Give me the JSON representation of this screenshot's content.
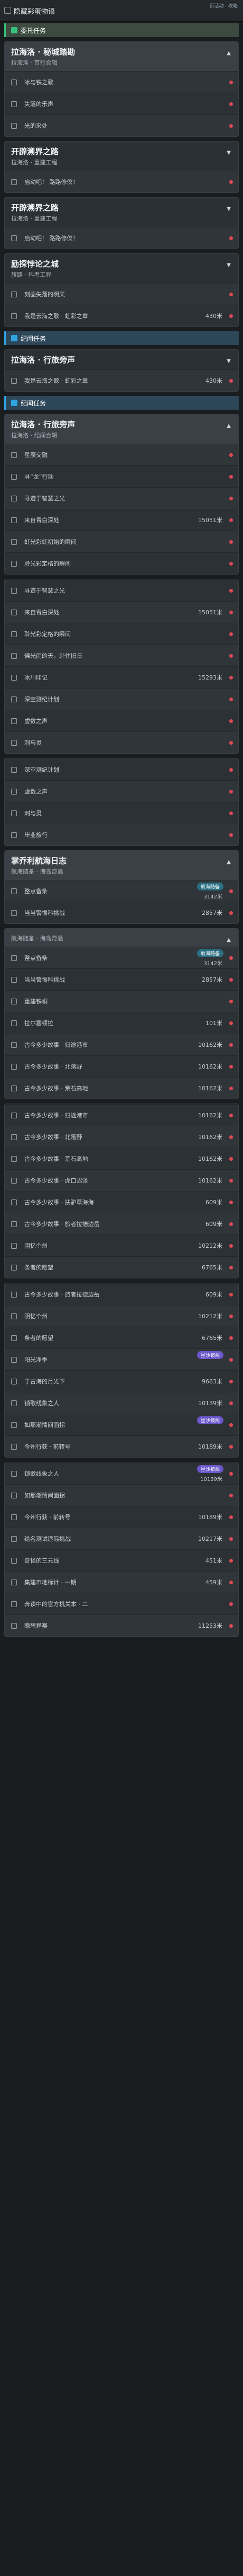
{
  "window": {
    "title": "隐藏彩蛋物语",
    "watermark": "新活动 · 攻略"
  },
  "sections": [
    {
      "type": "cat",
      "color": "green",
      "label": "委托任务"
    },
    {
      "type": "quest",
      "title": "拉海洛 · 秘城踏勘",
      "subtitle": "拉海洛 · 首行合辑",
      "open": true,
      "rows": [
        {
          "label": "冰与铁之歌"
        },
        {
          "label": "失落的乐声"
        },
        {
          "label": "光的来处"
        }
      ]
    },
    {
      "type": "quest",
      "title": "开辟溯界之路",
      "subtitle": "拉海洛 · 重建工程",
      "open": false,
      "rows": [
        {
          "label": "启动吧！ 路路修仪！"
        }
      ]
    },
    {
      "type": "quest",
      "title": "开辟溯界之路",
      "subtitle": "拉海洛 · 重建工程",
      "open": false,
      "rows": [
        {
          "label": "启动吧！ 路路修仪！"
        }
      ]
    },
    {
      "type": "quest",
      "title": "励探悖论之城",
      "subtitle": "旗路 · 科考工程",
      "open": false,
      "rows": [
        {
          "label": "刻画失落的明天"
        },
        {
          "label": "我是云海之歌 · 虹彩之章",
          "count": "430米"
        }
      ]
    },
    {
      "type": "cat",
      "color": "blue",
      "label": "纪闻任务"
    },
    {
      "type": "quest",
      "title": "拉海洛 · 行旅旁声",
      "subtitle": "",
      "open": false,
      "rows": [
        {
          "label": "我是云海之歌 · 虹彩之章",
          "count": "430米"
        }
      ]
    },
    {
      "type": "cat",
      "color": "blue",
      "label": "纪闻任务"
    },
    {
      "type": "quest",
      "title": "拉海洛 · 行旅旁声",
      "subtitle": "拉海洛 · 纪闻合辑",
      "open": true,
      "rows": [
        {
          "label": "星辰交融"
        },
        {
          "label": "寻“龙”行动"
        },
        {
          "label": "寻迹于智慧之光"
        },
        {
          "label": "来自青白深处",
          "count": "15051米"
        },
        {
          "label": "虹光彩虹初始的瞬间"
        },
        {
          "label": "聆光彩定格的瞬间"
        }
      ]
    },
    {
      "type": "quest",
      "title": "",
      "subtitle": "",
      "open": true,
      "rows": [
        {
          "label": "寻迹于智慧之光"
        },
        {
          "label": "来自青白深处",
          "count": "15051米"
        },
        {
          "label": "聆光彩定格的瞬间"
        },
        {
          "label": "佛光闹的天，赴往旧日"
        },
        {
          "label": "冰川印记",
          "count": "15293米"
        },
        {
          "label": "深空测纪计划"
        },
        {
          "label": "虚数之声"
        },
        {
          "label": "刺与灵"
        }
      ]
    },
    {
      "type": "quest",
      "title": "",
      "subtitle": "",
      "open": true,
      "rows": [
        {
          "label": "深空测纪计划"
        },
        {
          "label": "虚数之声"
        },
        {
          "label": "刺与灵"
        },
        {
          "label": "毕业旅行"
        }
      ]
    },
    {
      "type": "quest",
      "title": "掌乔利航海日志",
      "subtitle": "航海随备 · 海岛奇遇",
      "open": true,
      "rows": [
        {
          "label": "整点备条",
          "count": "3142米",
          "tag": "航海随备"
        },
        {
          "label": "当当警惕科挑战",
          "count": "2857米"
        }
      ]
    },
    {
      "type": "quest",
      "title": "",
      "subtitle": "航海随备 · 海岛奇遇",
      "open": true,
      "rows": [
        {
          "label": "整点备条",
          "count": "3142米",
          "tag": "航海随备"
        },
        {
          "label": "当当警惕科挑战",
          "count": "2857米"
        },
        {
          "label": "重建铁峒"
        },
        {
          "label": "拉尔塞顿拉",
          "count": "101米"
        },
        {
          "label": "古今多少故事 · 归途港市",
          "count": "10162米"
        },
        {
          "label": "古今多少故事 · 北落野",
          "count": "10162米"
        },
        {
          "label": "古今多少故事 · 荒石高地",
          "count": "10162米"
        }
      ]
    },
    {
      "type": "quest",
      "title": "",
      "subtitle": "",
      "open": true,
      "rows": [
        {
          "label": "古今多少故事 · 归途港市",
          "count": "10162米"
        },
        {
          "label": "古今多少故事 · 北落野",
          "count": "10162米"
        },
        {
          "label": "古今多少故事 · 荒石高地",
          "count": "10162米"
        },
        {
          "label": "古今多少故事 · 虎口沼泽",
          "count": "10162米"
        },
        {
          "label": "古今多少故事 · 扶驴草海海",
          "count": "609米"
        },
        {
          "label": "古今多少故事 · 旅者拉德边岳",
          "count": "609米"
        },
        {
          "label": "阴忆个州",
          "count": "10212米"
        },
        {
          "label": "条者的愿望",
          "count": "6765米"
        }
      ]
    },
    {
      "type": "quest",
      "title": "",
      "subtitle": "",
      "open": true,
      "rows": [
        {
          "label": "古今多少故事 · 旅者拉德边岳",
          "count": "609米"
        },
        {
          "label": "阴忆个州",
          "count": "10212米"
        },
        {
          "label": "条者的愿望",
          "count": "6765米"
        },
        {
          "label": "阳光净季",
          "tag": "星沙镜阁"
        },
        {
          "label": "于古海的月光下",
          "count": "9663米"
        },
        {
          "label": "锁歌线象之人",
          "count": "10139米"
        },
        {
          "label": "如那潮情间面拐",
          "tag": "星沙镜阁"
        },
        {
          "label": "今州行获 · 前转号",
          "count": "10189米"
        }
      ]
    },
    {
      "type": "quest",
      "title": "",
      "subtitle": "",
      "open": true,
      "rows": [
        {
          "label": "锁歌线象之人",
          "count": "10139米",
          "tag": "星沙镜阁"
        },
        {
          "label": "如那潮情间面拐"
        },
        {
          "label": "今州行获 · 前转号",
          "count": "10189米"
        },
        {
          "label": "给名测试适际挑战",
          "count": "10217米"
        },
        {
          "label": "奇怪的三元线",
          "count": "451米"
        },
        {
          "label": "集建市地标计 · 一期",
          "count": "459米"
        },
        {
          "label": "奔读中的官方机关本 · 二"
        },
        {
          "label": "瞭想异赛",
          "count": "11253米"
        }
      ]
    }
  ]
}
